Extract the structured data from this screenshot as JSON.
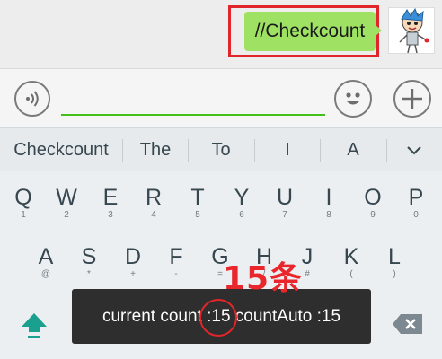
{
  "chat": {
    "message": "//Checkcount"
  },
  "suggestions": [
    "Checkcount",
    "The",
    "To",
    "I",
    "A"
  ],
  "keyboard": {
    "row1": [
      {
        "key": "Q",
        "sub": "1"
      },
      {
        "key": "W",
        "sub": "2"
      },
      {
        "key": "E",
        "sub": "3"
      },
      {
        "key": "R",
        "sub": "4"
      },
      {
        "key": "T",
        "sub": "5"
      },
      {
        "key": "Y",
        "sub": "6"
      },
      {
        "key": "U",
        "sub": "7"
      },
      {
        "key": "I",
        "sub": "8"
      },
      {
        "key": "O",
        "sub": "9"
      },
      {
        "key": "P",
        "sub": "0"
      }
    ],
    "row2": [
      {
        "key": "A",
        "sub": "@"
      },
      {
        "key": "S",
        "sub": "*"
      },
      {
        "key": "D",
        "sub": "+"
      },
      {
        "key": "F",
        "sub": "-"
      },
      {
        "key": "G",
        "sub": "="
      },
      {
        "key": "H",
        "sub": "/"
      },
      {
        "key": "J",
        "sub": "#"
      },
      {
        "key": "K",
        "sub": "("
      },
      {
        "key": "L",
        "sub": ")"
      }
    ]
  },
  "toast": {
    "text": "current count :15 countAuto :15"
  },
  "annotation": {
    "text": "15条"
  },
  "colors": {
    "bubble": "#9fe163",
    "highlight": "#e0262b",
    "input_underline": "#45c01a",
    "toast_bg": "#2e2e2e"
  }
}
